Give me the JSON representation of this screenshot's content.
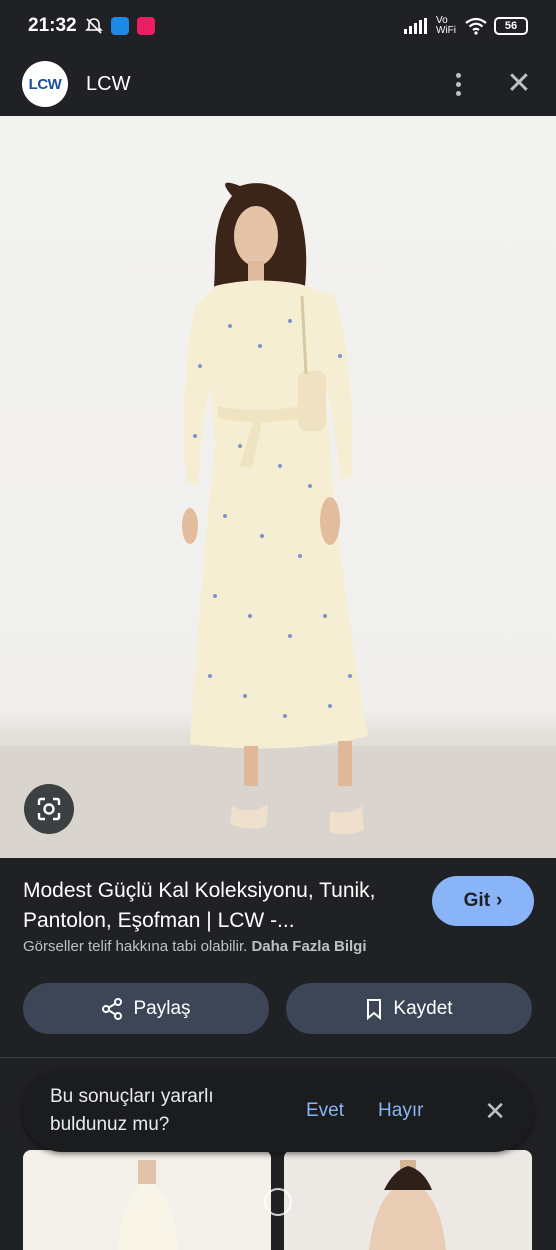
{
  "status_bar": {
    "time": "21:32",
    "network_label": "Vo WiFi",
    "battery": "56",
    "icons": [
      "mute-bell-icon",
      "blue-app-icon",
      "pink-app-icon",
      "signal-icon",
      "wifi-icon",
      "battery-icon"
    ]
  },
  "header": {
    "logo_text": "LCW",
    "site_name": "LCW"
  },
  "product": {
    "title": "Modest Güçlü Kal Koleksiyonu, Tunik, Pantolon, Eşofman | LCW -...",
    "visit_label": "Git",
    "copyright_text": "Görseller telif hakkına tabi olabilir.",
    "more_info_label": "Daha Fazla Bilgi",
    "share_label": "Paylaş",
    "save_label": "Kaydet"
  },
  "feedback": {
    "question": "Bu sonuçları yararlı buldunuz mu?",
    "yes_label": "Evet",
    "no_label": "Hayır"
  },
  "colors": {
    "background": "#202124",
    "accent": "#8ab4f8",
    "button_bg": "#3c4657"
  }
}
